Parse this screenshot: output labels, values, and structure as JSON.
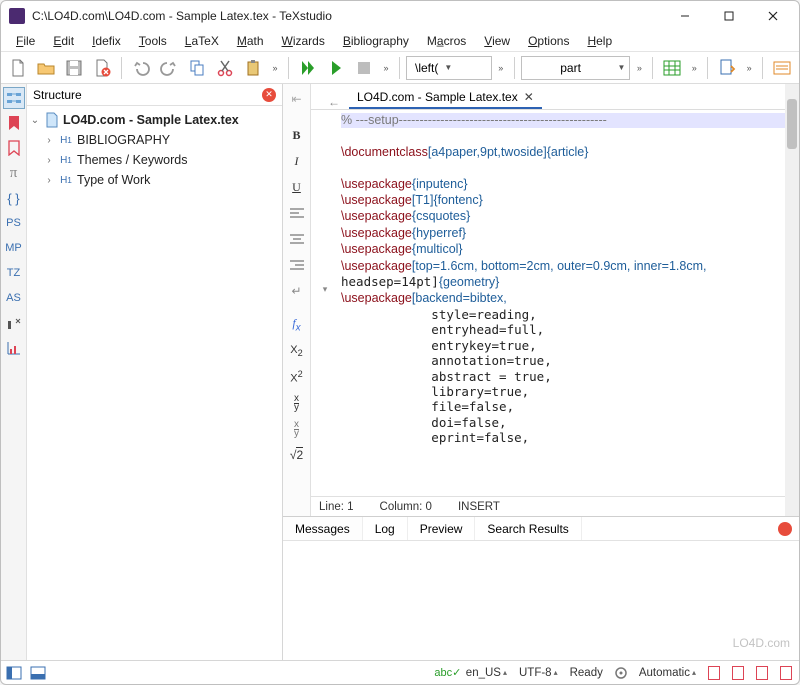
{
  "titlebar": {
    "text": "C:\\LO4D.com\\LO4D.com - Sample Latex.tex - TeXstudio"
  },
  "menubar": [
    "File",
    "Edit",
    "Idefix",
    "Tools",
    "LaTeX",
    "Math",
    "Wizards",
    "Bibliography",
    "Macros",
    "View",
    "Options",
    "Help"
  ],
  "toolbar": {
    "dd1_label": "\\left(",
    "dd2_label": "part"
  },
  "sidebar": {
    "title": "Structure",
    "tree": {
      "root": "LO4D.com - Sample Latex.tex",
      "children": [
        {
          "label": "BIBLIOGRAPHY",
          "icon": "H1"
        },
        {
          "label": "Themes / Keywords",
          "icon": "H1"
        },
        {
          "label": "Type of Work",
          "icon": "H1"
        }
      ]
    }
  },
  "left_iconbar": [
    "PS",
    "MP",
    "TZ",
    "AS"
  ],
  "tab": {
    "label": "LO4D.com - Sample Latex.tex"
  },
  "code_lines": [
    {
      "t": "comment",
      "txt": "% ---setup--------------------------------------------------"
    },
    {
      "t": "blank"
    },
    {
      "t": "cmd",
      "cmd": "\\documentclass",
      "opt": "[a4paper,9pt,twoside]",
      "arg": "{article}"
    },
    {
      "t": "blank"
    },
    {
      "t": "cmd",
      "cmd": "\\usepackage",
      "arg": "{inputenc}"
    },
    {
      "t": "cmd",
      "cmd": "\\usepackage",
      "opt": "[T1]",
      "arg": "{fontenc}"
    },
    {
      "t": "cmd",
      "cmd": "\\usepackage",
      "arg": "{csquotes}"
    },
    {
      "t": "cmd",
      "cmd": "\\usepackage",
      "arg": "{hyperref}"
    },
    {
      "t": "cmd",
      "cmd": "\\usepackage",
      "arg": "{multicol}"
    },
    {
      "t": "cmd",
      "cmd": "\\usepackage",
      "opt": "[top=1.6cm, bottom=2cm, outer=0.9cm, inner=1.8cm, ",
      "cont": true
    },
    {
      "t": "plain",
      "txt": "headsep=14pt]",
      "arg": "{geometry}"
    },
    {
      "t": "cmd",
      "cmd": "\\usepackage",
      "opt": "[backend=bibtex,",
      "cont": true,
      "fold": true
    },
    {
      "t": "indent",
      "txt": "style=reading,"
    },
    {
      "t": "indent",
      "txt": "entryhead=full,"
    },
    {
      "t": "indent",
      "txt": "entrykey=true,"
    },
    {
      "t": "indent",
      "txt": "annotation=true,"
    },
    {
      "t": "indent",
      "txt": "abstract = true,"
    },
    {
      "t": "indent",
      "txt": "library=true,"
    },
    {
      "t": "indent",
      "txt": "file=false,"
    },
    {
      "t": "indent",
      "txt": "doi=false,"
    },
    {
      "t": "indent",
      "txt": "eprint=false,"
    }
  ],
  "status": {
    "line": "Line: 1",
    "col": "Column: 0",
    "mode": "INSERT"
  },
  "bottom_tabs": [
    "Messages",
    "Log",
    "Preview",
    "Search Results"
  ],
  "statusbar": {
    "lang": "en_US",
    "enc": "UTF-8",
    "ready": "Ready",
    "auto": "Automatic"
  },
  "watermark": "LO4D.com"
}
